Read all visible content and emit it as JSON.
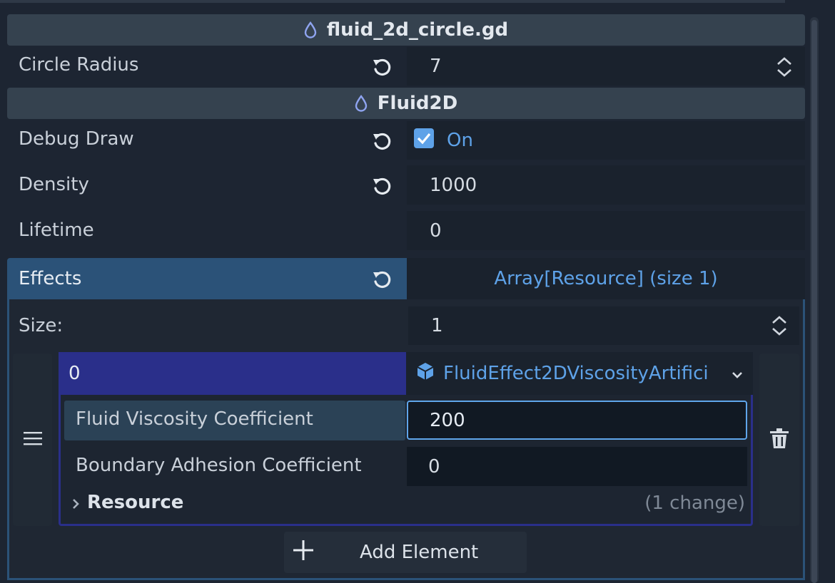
{
  "script_section": {
    "title": "fluid_2d_circle.gd",
    "icon": "water-drop-icon"
  },
  "circle_radius": {
    "label": "Circle Radius",
    "value": "7"
  },
  "class_section": {
    "title": "Fluid2D",
    "icon": "water-drop-icon"
  },
  "debug_draw": {
    "label": "Debug Draw",
    "checked": true,
    "value_label": "On"
  },
  "density": {
    "label": "Density",
    "value": "1000"
  },
  "lifetime": {
    "label": "Lifetime",
    "value": "0"
  },
  "effects": {
    "label": "Effects",
    "summary": "Array[Resource] (size 1)",
    "size_label": "Size:",
    "size_value": "1",
    "element": {
      "index": "0",
      "resource_name": "FluidEffect2DViscosityArtifici",
      "resource_icon": "cube-icon",
      "fluid_viscosity": {
        "label": "Fluid Viscosity Coefficient",
        "value": "200"
      },
      "boundary_adhesion": {
        "label": "Boundary Adhesion Coefficient",
        "value": "0"
      },
      "resource_group": {
        "label": "Resource",
        "changes": "(1 change)"
      }
    },
    "add_element_label": "Add Element"
  },
  "colors": {
    "accent": "#5ea2e8",
    "selected_row": "#2b5278",
    "element_header": "#2a2f8a",
    "background": "#1d2532"
  }
}
